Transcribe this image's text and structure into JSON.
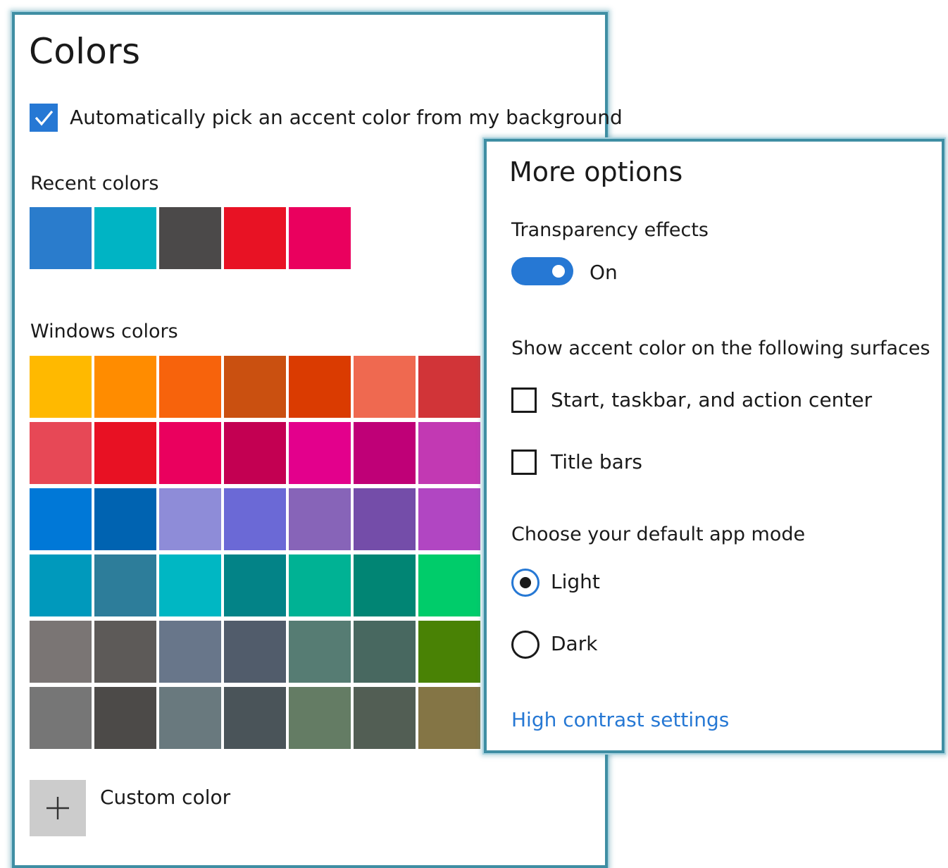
{
  "colors_panel": {
    "title": "Colors",
    "auto_accent": {
      "label": "Automatically pick an accent color from my background",
      "checked": true
    },
    "recent_colors_heading": "Recent colors",
    "recent_colors": [
      "#2a7ccc",
      "#00b4c4",
      "#4b4949",
      "#e81224",
      "#ea005e"
    ],
    "windows_colors_heading": "Windows colors",
    "windows_colors": [
      [
        "#ffb900",
        "#ff8c00",
        "#f7630c",
        "#ca5010",
        "#da3b01",
        "#ef6950",
        "#d13438"
      ],
      [
        "#e74856",
        "#e81123",
        "#ea005e",
        "#c30052",
        "#e3008c",
        "#bf0077",
        "#c239b3"
      ],
      [
        "#0078d7",
        "#0063b1",
        "#8e8cd8",
        "#6b69d6",
        "#8764b8",
        "#744da9",
        "#b146c2"
      ],
      [
        "#0099bc",
        "#2d7d9a",
        "#00b7c3",
        "#038387",
        "#00b294",
        "#018574",
        "#00cc6a"
      ],
      [
        "#7a7574",
        "#5d5a58",
        "#68768a",
        "#515c6b",
        "#567c73",
        "#486860",
        "#498205"
      ],
      [
        "#767676",
        "#4c4a48",
        "#69797e",
        "#4a5459",
        "#647c64",
        "#525e54",
        "#847545"
      ]
    ],
    "custom_color": {
      "label": "Custom color",
      "icon": "plus-icon"
    }
  },
  "more_options": {
    "title": "More options",
    "transparency": {
      "label": "Transparency effects",
      "state_label": "On",
      "on": true
    },
    "surfaces_label": "Show accent color on the following surfaces",
    "surfaces": {
      "start": {
        "label": "Start, taskbar, and action center",
        "checked": false
      },
      "title_bars": {
        "label": "Title bars",
        "checked": false
      }
    },
    "app_mode_label": "Choose your default app mode",
    "app_modes": {
      "light": {
        "label": "Light",
        "selected": true
      },
      "dark": {
        "label": "Dark",
        "selected": false
      }
    },
    "high_contrast_link": "High contrast settings"
  },
  "accent_color": "#2678d4",
  "frame_color": "#3f8ea3"
}
